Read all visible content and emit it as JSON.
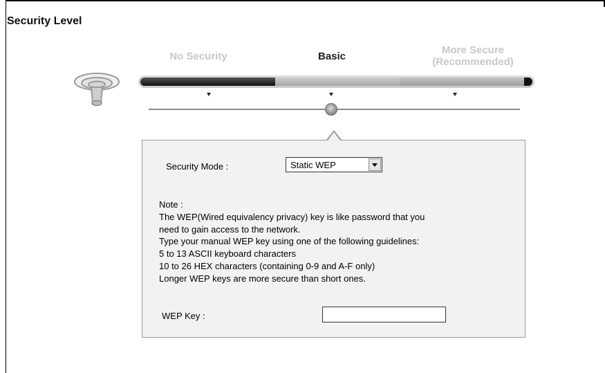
{
  "page": {
    "title": "Security Level"
  },
  "levels": [
    {
      "label": "No Security",
      "sub": ""
    },
    {
      "label": "Basic",
      "sub": ""
    },
    {
      "label": "More Secure",
      "sub": "(Recommended)"
    }
  ],
  "selected_level_index": 1,
  "security_mode": {
    "label": "Security Mode :",
    "value": "Static WEP",
    "options_visible": [
      "Static WEP"
    ]
  },
  "note": {
    "heading": "Note :",
    "lines": [
      "The WEP(Wired equivalency privacy) key is like password that you",
      "need to gain access to the network.",
      "Type your manual WEP key using one of the following guidelines:",
      "5 to 13 ASCII keyboard characters",
      "10 to 26 HEX characters (containing 0-9 and A-F only)",
      "Longer WEP keys are more secure than short ones."
    ]
  },
  "wep_key": {
    "label": "WEP Key :",
    "value": ""
  },
  "icons": {
    "wireless": "wireless-router-icon"
  },
  "colors": {
    "active_text": "#222222",
    "inactive_text": "#c8c8c8",
    "panel_bg": "#f2f2f2"
  }
}
